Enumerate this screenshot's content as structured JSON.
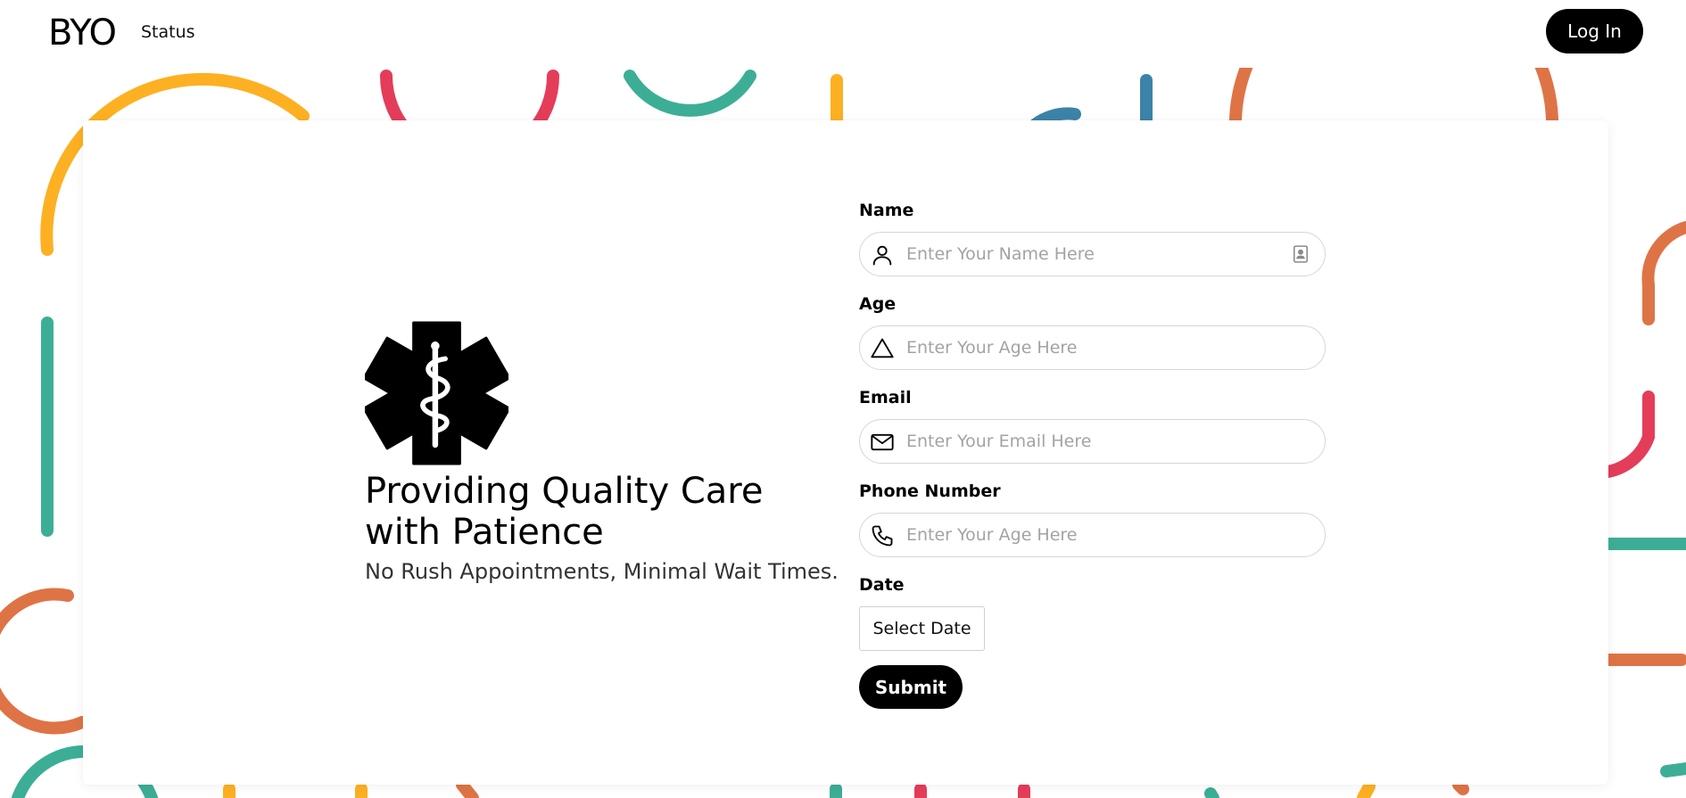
{
  "header": {
    "logo": "BYO",
    "nav": {
      "status_label": "Status"
    },
    "login_label": "Log In"
  },
  "hero": {
    "icon": "star-of-life-icon",
    "title": "Providing Quality Care with Patience",
    "subtitle": "No Rush Appointments, Minimal Wait Times."
  },
  "form": {
    "name": {
      "label": "Name",
      "placeholder": "Enter Your Name Here",
      "icon": "user-icon",
      "trailing_icon": "contact-card-icon"
    },
    "age": {
      "label": "Age",
      "placeholder": "Enter Your Age Here",
      "icon": "triangle-icon"
    },
    "email": {
      "label": "Email",
      "placeholder": "Enter Your Email Here",
      "icon": "mail-icon"
    },
    "phone": {
      "label": "Phone Number",
      "placeholder": "Enter Your Age Here",
      "icon": "phone-icon"
    },
    "date": {
      "label": "Date",
      "button_label": "Select Date"
    },
    "submit_label": "Submit"
  },
  "colors": {
    "primary": "#000000",
    "decor_yellow": "#FDB022",
    "decor_red": "#E43D5A",
    "decor_teal": "#3DAE96",
    "decor_orange": "#DE7446",
    "decor_blue": "#3C83A8"
  }
}
